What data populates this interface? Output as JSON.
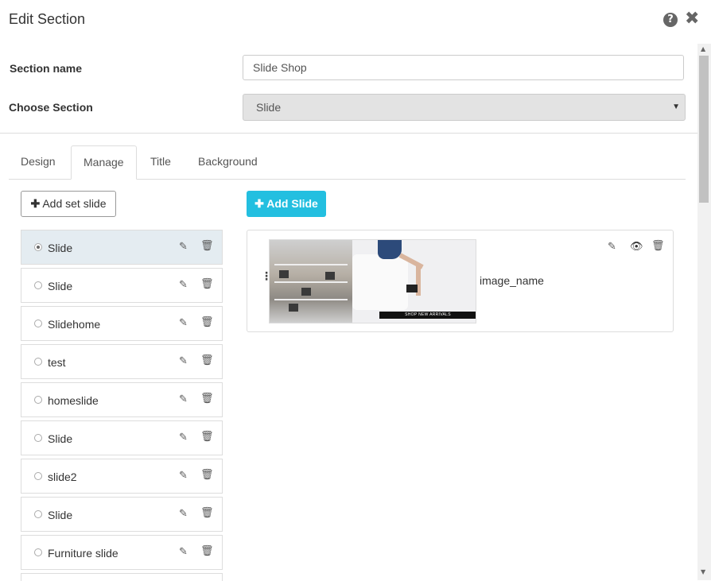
{
  "dialog": {
    "title": "Edit Section"
  },
  "form": {
    "section_name_label": "Section name",
    "section_name_value": "Slide Shop",
    "choose_section_label": "Choose Section",
    "choose_section_value": "Slide"
  },
  "tabs": [
    {
      "label": "Design"
    },
    {
      "label": "Manage"
    },
    {
      "label": "Title"
    },
    {
      "label": "Background"
    }
  ],
  "buttons": {
    "add_set_slide": "Add set slide",
    "add_slide": "Add Slide"
  },
  "slide_sets": [
    {
      "name": "Slide",
      "selected": true
    },
    {
      "name": "Slide",
      "selected": false
    },
    {
      "name": "Slidehome",
      "selected": false
    },
    {
      "name": "test",
      "selected": false
    },
    {
      "name": "homeslide",
      "selected": false
    },
    {
      "name": "Slide",
      "selected": false
    },
    {
      "name": "slide2",
      "selected": false
    },
    {
      "name": "Slide",
      "selected": false
    },
    {
      "name": "Furniture slide",
      "selected": false
    }
  ],
  "slide_card": {
    "image_name": "image_name",
    "banner_text": "SHOP NEW ARRIVALS"
  },
  "colors": {
    "primary_button": "#23bfe0",
    "selected_row": "#e4ecf1"
  }
}
